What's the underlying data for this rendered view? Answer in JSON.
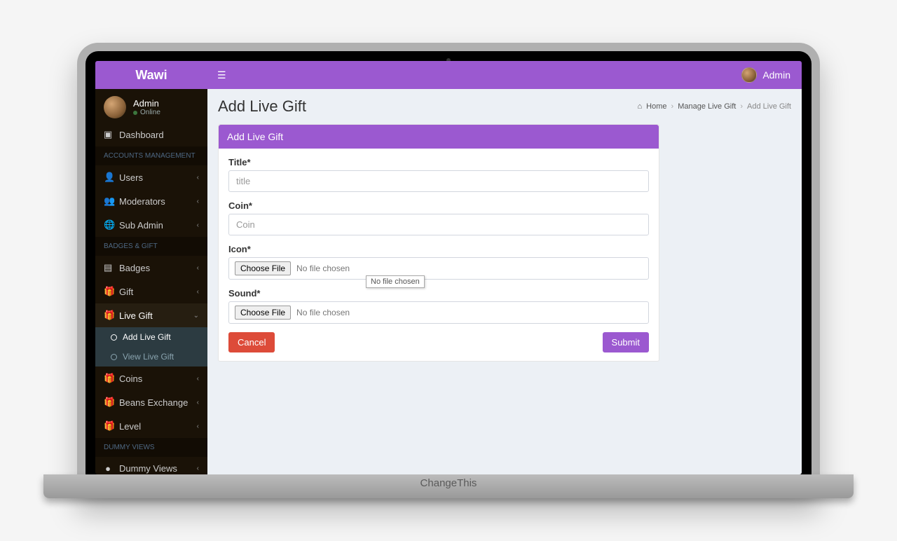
{
  "brand": "Wawi",
  "topbar": {
    "username": "Admin"
  },
  "user_panel": {
    "name": "Admin",
    "status": "Online"
  },
  "sidebar": {
    "dashboard": "Dashboard",
    "headers": {
      "accounts": "ACCOUNTS MANAGEMENT",
      "badges": "BADGES & GIFT",
      "dummy": "Dummy Views"
    },
    "items": {
      "users": "Users",
      "moderators": "Moderators",
      "subadmin": "Sub Admin",
      "badges": "Badges",
      "gift": "Gift",
      "livegift": "Live Gift",
      "coins": "Coins",
      "beans": "Beans Exchange",
      "level": "Level",
      "dummyviews": "Dummy Views"
    },
    "submenu": {
      "addlive": "Add Live Gift",
      "viewlive": "View Live Gift"
    }
  },
  "page": {
    "title": "Add Live Gift",
    "crumbs": {
      "home": "Home",
      "managelive": "Manage Live Gift",
      "addlive": "Add Live Gift"
    },
    "panel_title": "Add Live Gift"
  },
  "form": {
    "title_label": "Title*",
    "title_placeholder": "title",
    "coin_label": "Coin*",
    "coin_placeholder": "Coin",
    "icon_label": "Icon*",
    "sound_label": "Sound*",
    "choose_file": "Choose File",
    "no_file": "No file chosen",
    "cancel": "Cancel",
    "submit": "Submit",
    "tooltip": "No file chosen"
  },
  "device": {
    "text": "ChangeThis"
  }
}
